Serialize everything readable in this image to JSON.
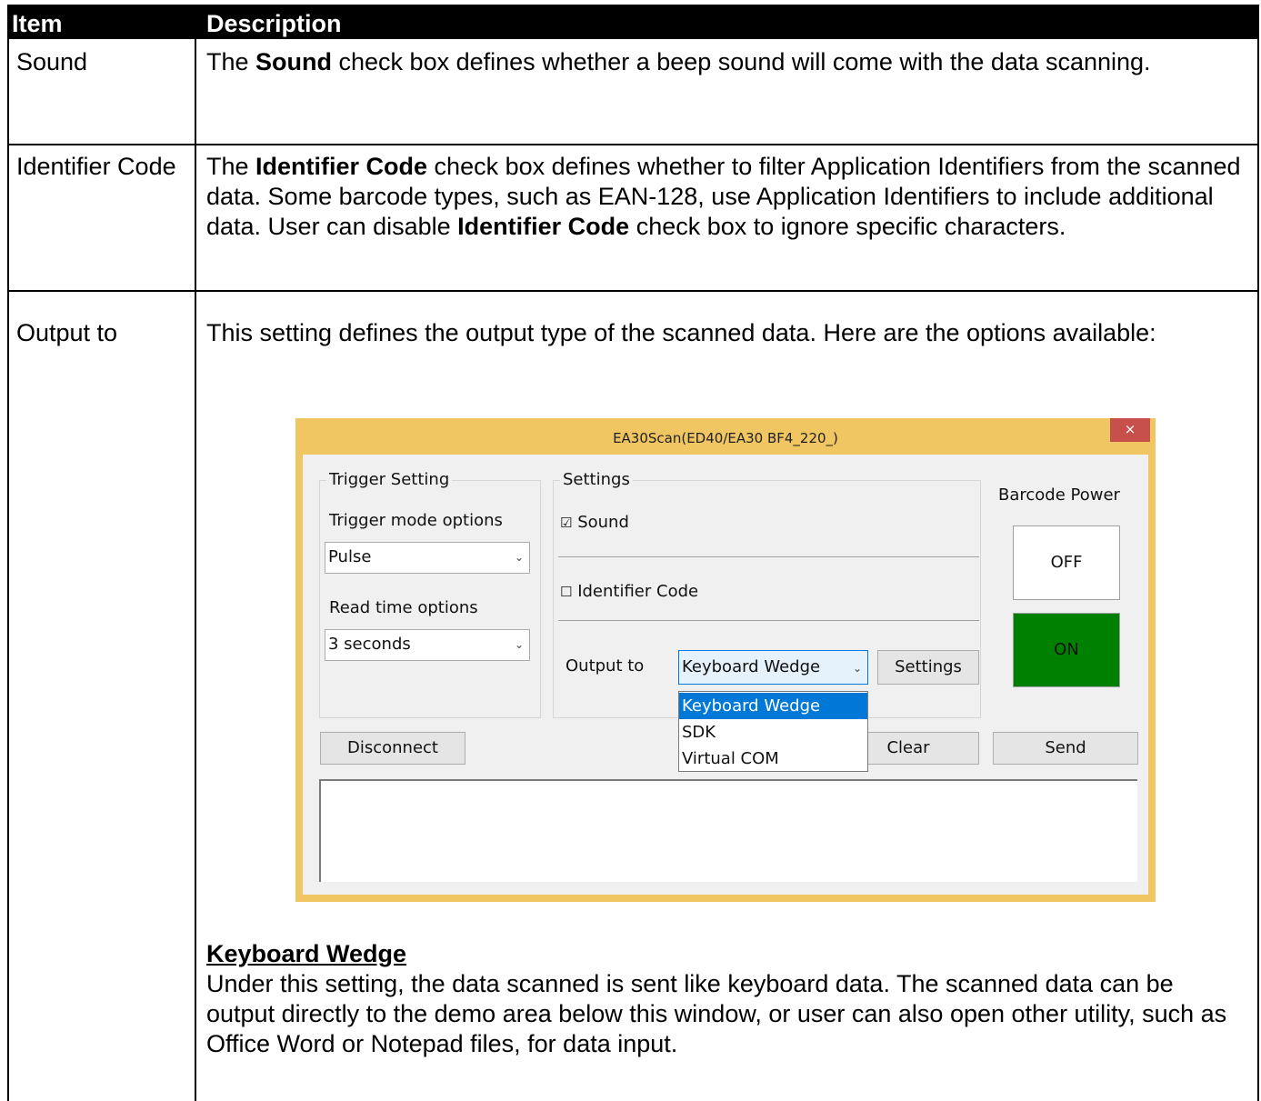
{
  "table": {
    "headers": [
      "Item",
      "Description"
    ],
    "rows": [
      {
        "item": "Sound",
        "desc_parts": [
          "The ",
          "Sound",
          " check box defines whether a beep sound will come with the data scanning."
        ]
      },
      {
        "item": "Identifier Code",
        "desc_parts": [
          "The ",
          "Identifier Code",
          " check box defines whether to filter Application Identifiers from the scanned data. Some barcode types, such as EAN-128, use Application Identifiers to include additional data. User can disable ",
          "Identifier Code",
          " check box to ignore specific characters."
        ]
      },
      {
        "item": "Output to",
        "desc_intro": "This setting defines the output type of the scanned data. Here are the options available:",
        "keyboard_wedge_heading": "Keyboard Wedge",
        "keyboard_wedge_text": "Under this setting, the data scanned is sent like keyboard data. The scanned data can be output directly to the demo area below this window, or user can also open other utility, such as Office Word or Notepad files, for data input."
      }
    ]
  },
  "dialog": {
    "title": "EA30Scan(ED40/EA30 BF4_220_)",
    "close_glyph": "×",
    "trigger_group": {
      "title": "Trigger Setting",
      "mode_label": "Trigger mode options",
      "mode_value": "Pulse",
      "read_label": "Read time options",
      "read_value": "3 seconds"
    },
    "settings_group": {
      "title": "Settings",
      "sound_label": "Sound",
      "sound_checked": true,
      "identifier_label": "Identifier Code",
      "identifier_checked": false,
      "output_label": "Output to",
      "output_value": "Keyboard Wedge",
      "settings_button": "Settings"
    },
    "power": {
      "label": "Barcode Power",
      "off_label": "OFF",
      "on_label": "ON",
      "on_color": "#008000"
    },
    "dropdown_options": [
      "Keyboard Wedge",
      "SDK",
      "Virtual COM"
    ],
    "selected_option": "Keyboard Wedge",
    "disconnect_button": "Disconnect",
    "clear_button": "Clear",
    "send_button": "Send",
    "check_on": "☑",
    "check_off": "☐",
    "chevron": "⌄"
  }
}
